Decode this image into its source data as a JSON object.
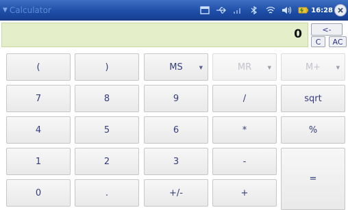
{
  "window": {
    "title": "Calculator",
    "clock": "16:28",
    "accent": "#1f4fa8"
  },
  "display": {
    "value": "0",
    "backspace_label": "<-",
    "clear_label": "C",
    "all_clear_label": "AC"
  },
  "keys": {
    "open_paren": "(",
    "close_paren": ")",
    "ms": "MS",
    "mr": "MR",
    "m_plus": "M+",
    "seven": "7",
    "eight": "8",
    "nine": "9",
    "divide": "/",
    "sqrt": "sqrt",
    "four": "4",
    "five": "5",
    "six": "6",
    "multiply": "*",
    "percent": "%",
    "one": "1",
    "two": "2",
    "three": "3",
    "minus": "-",
    "equals": "=",
    "zero": "0",
    "decimal": ".",
    "negate": "+/-",
    "plus": "+"
  },
  "tray_icons": [
    "window-icon",
    "usb-icon",
    "signal-icon",
    "bluetooth-icon",
    "wifi-icon",
    "volume-icon",
    "battery-icon"
  ]
}
